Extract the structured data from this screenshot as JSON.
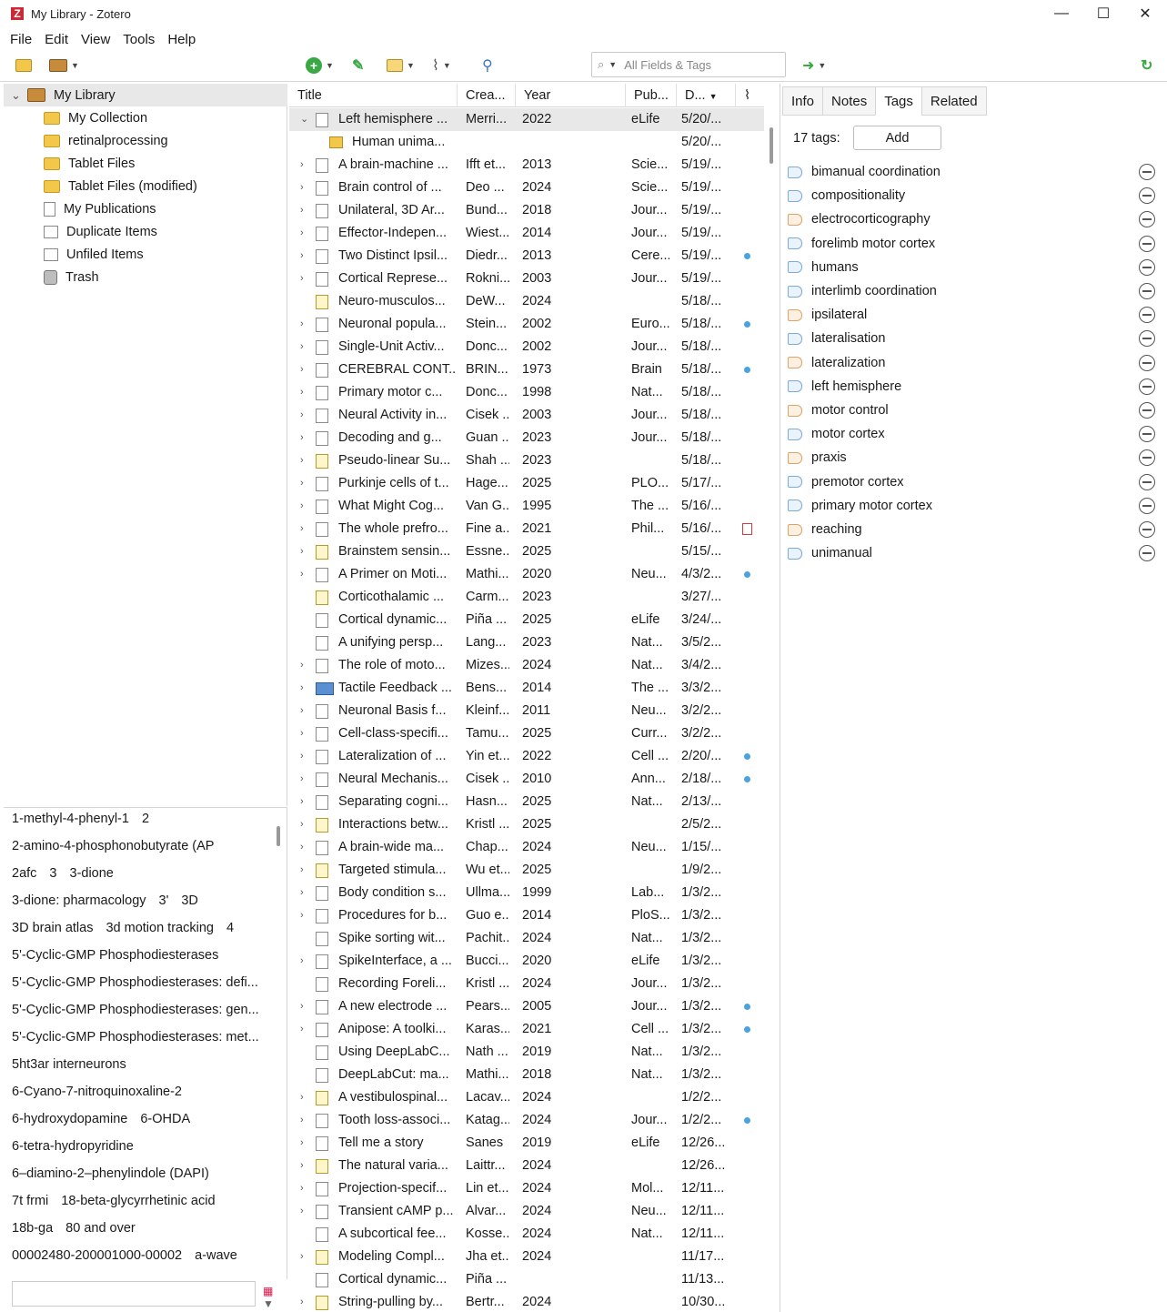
{
  "window": {
    "title": "My Library - Zotero",
    "logo": "Z",
    "min": "—",
    "max": "☐",
    "close": "✕"
  },
  "menu": [
    "File",
    "Edit",
    "View",
    "Tools",
    "Help"
  ],
  "search": {
    "placeholder": "All Fields & Tags",
    "icon": "⌕"
  },
  "collections": [
    {
      "label": "My Library",
      "icon": "library-icon"
    },
    {
      "label": "My Collection",
      "icon": "folder-icon"
    },
    {
      "label": "retinalprocessing",
      "icon": "folder-icon"
    },
    {
      "label": "Tablet Files",
      "icon": "folder-icon"
    },
    {
      "label": "Tablet Files (modified)",
      "icon": "folder-icon"
    },
    {
      "label": "My Publications",
      "icon": "document-icon"
    },
    {
      "label": "Duplicate Items",
      "icon": "duplicate-icon"
    },
    {
      "label": "Unfiled Items",
      "icon": "unfiled-icon"
    },
    {
      "label": "Trash",
      "icon": "trash-icon"
    }
  ],
  "tag_selector": {
    "lines": [
      [
        "1-methyl-4-phenyl-1",
        "2"
      ],
      [
        "2-amino-4-phosphonobutyrate (AP"
      ],
      [
        "2afc",
        "3",
        "3-dione"
      ],
      [
        "3-dione: pharmacology",
        "3'",
        "3D"
      ],
      [
        "3D brain atlas",
        "3d motion tracking",
        "4"
      ],
      [
        "5'-Cyclic-GMP Phosphodiesterases"
      ],
      [
        "5'-Cyclic-GMP Phosphodiesterases: defi..."
      ],
      [
        "5'-Cyclic-GMP Phosphodiesterases: gen..."
      ],
      [
        "5'-Cyclic-GMP Phosphodiesterases: met..."
      ],
      [
        "5ht3ar interneurons"
      ],
      [
        "6-Cyano-7-nitroquinoxaline-2"
      ],
      [
        "6-hydroxydopamine",
        "6-OHDA"
      ],
      [
        "6-tetra-hydropyridine"
      ],
      [
        "6–diamino-2–phenylindole (DAPI)"
      ],
      [
        "7t frmi",
        "18-beta-glycyrrhetinic acid"
      ],
      [
        "18b-ga",
        "80 and over"
      ],
      [
        "00002480-200001000-00002",
        "a-wave"
      ]
    ],
    "filter_value": ""
  },
  "columns": {
    "title": "Title",
    "creator": "Crea...",
    "year": "Year",
    "publication": "Pub...",
    "date": "D...",
    "sort_arrow": "▼"
  },
  "items": [
    {
      "t": "Left hemisphere ...",
      "c": "Merri...",
      "y": "2022",
      "p": "eLife",
      "d": "5/20/...",
      "k": "doc",
      "tw": "⌄",
      "sel": true
    },
    {
      "t": "Human unima...",
      "c": "",
      "y": "",
      "p": "",
      "d": "5/20/...",
      "k": "att",
      "child": true
    },
    {
      "t": "A brain-machine ...",
      "c": "Ifft et...",
      "y": "2013",
      "p": "Scie...",
      "d": "5/19/...",
      "k": "doc",
      "tw": "›"
    },
    {
      "t": "Brain control of ...",
      "c": "Deo ...",
      "y": "2024",
      "p": "Scie...",
      "d": "5/19/...",
      "k": "doc",
      "tw": "›"
    },
    {
      "t": "Unilateral, 3D Ar...",
      "c": "Bund...",
      "y": "2018",
      "p": "Jour...",
      "d": "5/19/...",
      "k": "doc",
      "tw": "›"
    },
    {
      "t": "Effector-Indepen...",
      "c": "Wiest...",
      "y": "2014",
      "p": "Jour...",
      "d": "5/19/...",
      "k": "doc",
      "tw": "›"
    },
    {
      "t": "Two Distinct Ipsil...",
      "c": "Diedr...",
      "y": "2013",
      "p": "Cere...",
      "d": "5/19/...",
      "k": "doc",
      "tw": "›",
      "dot": true
    },
    {
      "t": "Cortical Represe...",
      "c": "Rokni...",
      "y": "2003",
      "p": "Jour...",
      "d": "5/19/...",
      "k": "doc",
      "tw": "›"
    },
    {
      "t": "Neuro-musculos...",
      "c": "DeW...",
      "y": "2024",
      "p": "",
      "d": "5/18/...",
      "k": "note"
    },
    {
      "t": "Neuronal popula...",
      "c": "Stein...",
      "y": "2002",
      "p": "Euro...",
      "d": "5/18/...",
      "k": "doc",
      "tw": "›",
      "dot": true
    },
    {
      "t": "Single-Unit Activ...",
      "c": "Donc...",
      "y": "2002",
      "p": "Jour...",
      "d": "5/18/...",
      "k": "doc",
      "tw": "›"
    },
    {
      "t": "CEREBRAL CONT...",
      "c": "BRIN...",
      "y": "1973",
      "p": "Brain",
      "d": "5/18/...",
      "k": "doc",
      "tw": "›",
      "dot": true
    },
    {
      "t": "Primary motor c...",
      "c": "Donc...",
      "y": "1998",
      "p": "Nat...",
      "d": "5/18/...",
      "k": "doc",
      "tw": "›"
    },
    {
      "t": "Neural Activity in...",
      "c": "Cisek ...",
      "y": "2003",
      "p": "Jour...",
      "d": "5/18/...",
      "k": "doc",
      "tw": "›"
    },
    {
      "t": "Decoding and g...",
      "c": "Guan ...",
      "y": "2023",
      "p": "Jour...",
      "d": "5/18/...",
      "k": "doc",
      "tw": "›"
    },
    {
      "t": "Pseudo-linear Su...",
      "c": "Shah ...",
      "y": "2023",
      "p": "",
      "d": "5/18/...",
      "k": "note",
      "tw": "›"
    },
    {
      "t": "Purkinje cells of t...",
      "c": "Hage...",
      "y": "2025",
      "p": "PLO...",
      "d": "5/17/...",
      "k": "doc",
      "tw": "›"
    },
    {
      "t": "What Might Cog...",
      "c": "Van G...",
      "y": "1995",
      "p": "The ...",
      "d": "5/16/...",
      "k": "doc",
      "tw": "›"
    },
    {
      "t": "The whole prefro...",
      "c": "Fine a...",
      "y": "2021",
      "p": "Phil...",
      "d": "5/16/...",
      "k": "doc",
      "tw": "›",
      "pdf": true
    },
    {
      "t": "Brainstem sensin...",
      "c": "Essne...",
      "y": "2025",
      "p": "",
      "d": "5/15/...",
      "k": "note",
      "tw": "›"
    },
    {
      "t": "A Primer on Moti...",
      "c": "Mathi...",
      "y": "2020",
      "p": "Neu...",
      "d": "4/3/2...",
      "k": "doc",
      "tw": "›",
      "dot": true
    },
    {
      "t": "Corticothalamic ...",
      "c": "Carm...",
      "y": "2023",
      "p": "",
      "d": "3/27/...",
      "k": "note"
    },
    {
      "t": "Cortical dynamic...",
      "c": "Piña ...",
      "y": "2025",
      "p": "eLife",
      "d": "3/24/...",
      "k": "doc"
    },
    {
      "t": "A unifying persp...",
      "c": "Lang...",
      "y": "2023",
      "p": "Nat...",
      "d": "3/5/2...",
      "k": "doc"
    },
    {
      "t": "The role of moto...",
      "c": "Mizes...",
      "y": "2024",
      "p": "Nat...",
      "d": "3/4/2...",
      "k": "doc",
      "tw": "›"
    },
    {
      "t": "Tactile Feedback ...",
      "c": "Bens...",
      "y": "2014",
      "p": "The ...",
      "d": "3/3/2...",
      "k": "book",
      "tw": "›"
    },
    {
      "t": "Neuronal Basis f...",
      "c": "Kleinf...",
      "y": "2011",
      "p": "Neu...",
      "d": "3/2/2...",
      "k": "doc",
      "tw": "›"
    },
    {
      "t": "Cell-class-specifi...",
      "c": "Tamu...",
      "y": "2025",
      "p": "Curr...",
      "d": "3/2/2...",
      "k": "doc",
      "tw": "›"
    },
    {
      "t": "Lateralization of ...",
      "c": "Yin et...",
      "y": "2022",
      "p": "Cell ...",
      "d": "2/20/...",
      "k": "doc",
      "tw": "›",
      "dot": true
    },
    {
      "t": "Neural Mechanis...",
      "c": "Cisek ...",
      "y": "2010",
      "p": "Ann...",
      "d": "2/18/...",
      "k": "doc",
      "tw": "›",
      "dot": true
    },
    {
      "t": "Separating cogni...",
      "c": "Hasn...",
      "y": "2025",
      "p": "Nat...",
      "d": "2/13/...",
      "k": "doc",
      "tw": "›"
    },
    {
      "t": "Interactions betw...",
      "c": "Kristl ...",
      "y": "2025",
      "p": "",
      "d": "2/5/2...",
      "k": "note",
      "tw": "›"
    },
    {
      "t": "A brain-wide ma...",
      "c": "Chap...",
      "y": "2024",
      "p": "Neu...",
      "d": "1/15/...",
      "k": "doc",
      "tw": "›"
    },
    {
      "t": "Targeted stimula...",
      "c": "Wu et...",
      "y": "2025",
      "p": "",
      "d": "1/9/2...",
      "k": "note",
      "tw": "›"
    },
    {
      "t": "Body condition s...",
      "c": "Ullma...",
      "y": "1999",
      "p": "Lab...",
      "d": "1/3/2...",
      "k": "doc",
      "tw": "›"
    },
    {
      "t": "Procedures for b...",
      "c": "Guo e...",
      "y": "2014",
      "p": "PloS...",
      "d": "1/3/2...",
      "k": "doc",
      "tw": "›"
    },
    {
      "t": "Spike sorting wit...",
      "c": "Pachit...",
      "y": "2024",
      "p": "Nat...",
      "d": "1/3/2...",
      "k": "doc"
    },
    {
      "t": "SpikeInterface, a ...",
      "c": "Bucci...",
      "y": "2020",
      "p": "eLife",
      "d": "1/3/2...",
      "k": "doc",
      "tw": "›"
    },
    {
      "t": "Recording Foreli...",
      "c": "Kristl ...",
      "y": "2024",
      "p": "Jour...",
      "d": "1/3/2...",
      "k": "doc"
    },
    {
      "t": "A new electrode ...",
      "c": "Pears...",
      "y": "2005",
      "p": "Jour...",
      "d": "1/3/2...",
      "k": "doc",
      "tw": "›",
      "dot": true
    },
    {
      "t": "Anipose: A toolki...",
      "c": "Karas...",
      "y": "2021",
      "p": "Cell ...",
      "d": "1/3/2...",
      "k": "doc",
      "tw": "›",
      "dot": true
    },
    {
      "t": "Using DeepLabC...",
      "c": "Nath ...",
      "y": "2019",
      "p": "Nat...",
      "d": "1/3/2...",
      "k": "doc"
    },
    {
      "t": "DeepLabCut: ma...",
      "c": "Mathi...",
      "y": "2018",
      "p": "Nat...",
      "d": "1/3/2...",
      "k": "doc"
    },
    {
      "t": "A vestibulospinal...",
      "c": "Lacav...",
      "y": "2024",
      "p": "",
      "d": "1/2/2...",
      "k": "note",
      "tw": "›"
    },
    {
      "t": "Tooth loss-associ...",
      "c": "Katag...",
      "y": "2024",
      "p": "Jour...",
      "d": "1/2/2...",
      "k": "doc",
      "tw": "›",
      "dot": true
    },
    {
      "t": "Tell me a story",
      "c": "Sanes",
      "y": "2019",
      "p": "eLife",
      "d": "12/26...",
      "k": "doc",
      "tw": "›"
    },
    {
      "t": "The natural varia...",
      "c": "Laittr...",
      "y": "2024",
      "p": "",
      "d": "12/26...",
      "k": "note",
      "tw": "›"
    },
    {
      "t": "Projection-specif...",
      "c": "Lin et...",
      "y": "2024",
      "p": "Mol...",
      "d": "12/11...",
      "k": "doc",
      "tw": "›"
    },
    {
      "t": "Transient cAMP p...",
      "c": "Alvar...",
      "y": "2024",
      "p": "Neu...",
      "d": "12/11...",
      "k": "doc",
      "tw": "›"
    },
    {
      "t": "A subcortical fee...",
      "c": "Kosse...",
      "y": "2024",
      "p": "Nat...",
      "d": "12/11...",
      "k": "doc"
    },
    {
      "t": "Modeling Compl...",
      "c": "Jha et...",
      "y": "2024",
      "p": "",
      "d": "11/17...",
      "k": "note",
      "tw": "›"
    },
    {
      "t": "Cortical dynamic...",
      "c": "Piña ...",
      "y": "",
      "p": "",
      "d": "11/13...",
      "k": "doc"
    },
    {
      "t": "String-pulling by...",
      "c": "Bertr...",
      "y": "2024",
      "p": "",
      "d": "10/30...",
      "k": "note",
      "tw": "›"
    }
  ],
  "tabs": [
    "Info",
    "Notes",
    "Tags",
    "Related"
  ],
  "active_tab": "Tags",
  "tags_panel": {
    "count_label": "17 tags:",
    "add_label": "Add",
    "tags": [
      {
        "name": "bimanual coordination",
        "auto": false
      },
      {
        "name": "compositionality",
        "auto": false
      },
      {
        "name": "electrocorticography",
        "auto": true
      },
      {
        "name": "forelimb motor cortex",
        "auto": false
      },
      {
        "name": "humans",
        "auto": false
      },
      {
        "name": "interlimb coordination",
        "auto": false
      },
      {
        "name": "ipsilateral",
        "auto": true
      },
      {
        "name": "lateralisation",
        "auto": false
      },
      {
        "name": "lateralization",
        "auto": true
      },
      {
        "name": "left hemisphere",
        "auto": false
      },
      {
        "name": "motor control",
        "auto": true
      },
      {
        "name": "motor cortex",
        "auto": false
      },
      {
        "name": "praxis",
        "auto": true
      },
      {
        "name": "premotor cortex",
        "auto": false
      },
      {
        "name": "primary motor cortex",
        "auto": false
      },
      {
        "name": "reaching",
        "auto": true
      },
      {
        "name": "unimanual",
        "auto": false
      }
    ]
  },
  "colors": {
    "accent_blue": "#4aa3df",
    "green": "#3aa845",
    "selection": "#e8e8e8"
  }
}
